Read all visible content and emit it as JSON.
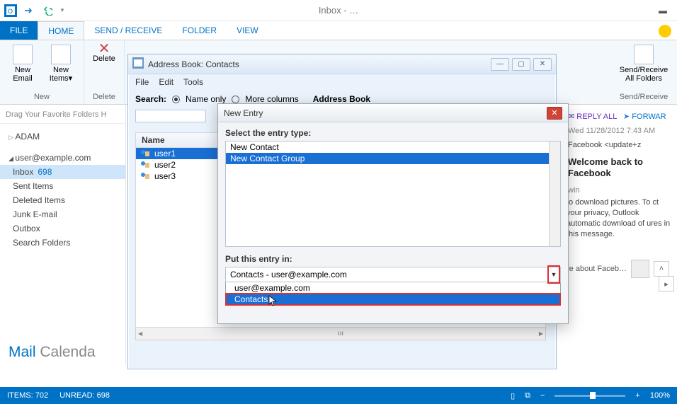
{
  "titlebar": {
    "title": "Inbox - …"
  },
  "tabs": {
    "file": "FILE",
    "home": "HOME",
    "sendrecv": "SEND / RECEIVE",
    "folder": "FOLDER",
    "view": "VIEW"
  },
  "ribbon": {
    "new_group": {
      "new_email": "New\nEmail",
      "new_items": "New\nItems▾",
      "label": "New"
    },
    "delete_group": {
      "delete": "Delete",
      "label": "Delete"
    },
    "sendrecv_group": {
      "button": "Send/Receive\nAll Folders",
      "label": "Send/Receive"
    }
  },
  "leftnav": {
    "dragline": "Drag Your Favorite Folders H",
    "root1": "ADAM",
    "account": "user@example.com",
    "folders": [
      {
        "name": "Inbox",
        "count": "698",
        "selected": true
      },
      {
        "name": "Sent Items"
      },
      {
        "name": "Deleted Items"
      },
      {
        "name": "Junk E-mail"
      },
      {
        "name": "Outbox"
      },
      {
        "name": "Search Folders"
      }
    ],
    "modules": {
      "mail": "Mail",
      "calendar": "Calenda"
    }
  },
  "reading": {
    "toolbar": {
      "replyall": "REPLY ALL",
      "forward": "FORWAR"
    },
    "date": "Wed 11/28/2012 7:43 AM",
    "from": "Facebook <update+z",
    "subject": "Welcome back to Facebook",
    "recipient": "win",
    "infotext": "to download pictures. To ct your privacy, Outlook automatic download of ures in this message.",
    "seeabout": "re about Faceb…"
  },
  "statusbar": {
    "items": "ITEMS: 702",
    "unread": "UNREAD: 698",
    "zoom": "100%"
  },
  "addressbook": {
    "title": "Address Book: Contacts",
    "menus": [
      "File",
      "Edit",
      "Tools"
    ],
    "search_label": "Search:",
    "opt_name": "Name only",
    "opt_more": "More columns",
    "book_label": "Address Book",
    "col_name": "Name",
    "contacts": [
      {
        "name": "user1",
        "selected": true
      },
      {
        "name": "user2"
      },
      {
        "name": "user3"
      }
    ],
    "hscroll_thumb": "ııı"
  },
  "newentry": {
    "title": "New Entry",
    "select_label": "Select the entry type:",
    "types": [
      {
        "label": "New Contact"
      },
      {
        "label": "New Contact Group",
        "selected": true
      }
    ],
    "put_label": "Put this entry in:",
    "dropdown_value": "Contacts - user@example.com",
    "options": [
      {
        "label": "user@example.com"
      },
      {
        "label": "Contacts",
        "selected": true
      }
    ]
  }
}
